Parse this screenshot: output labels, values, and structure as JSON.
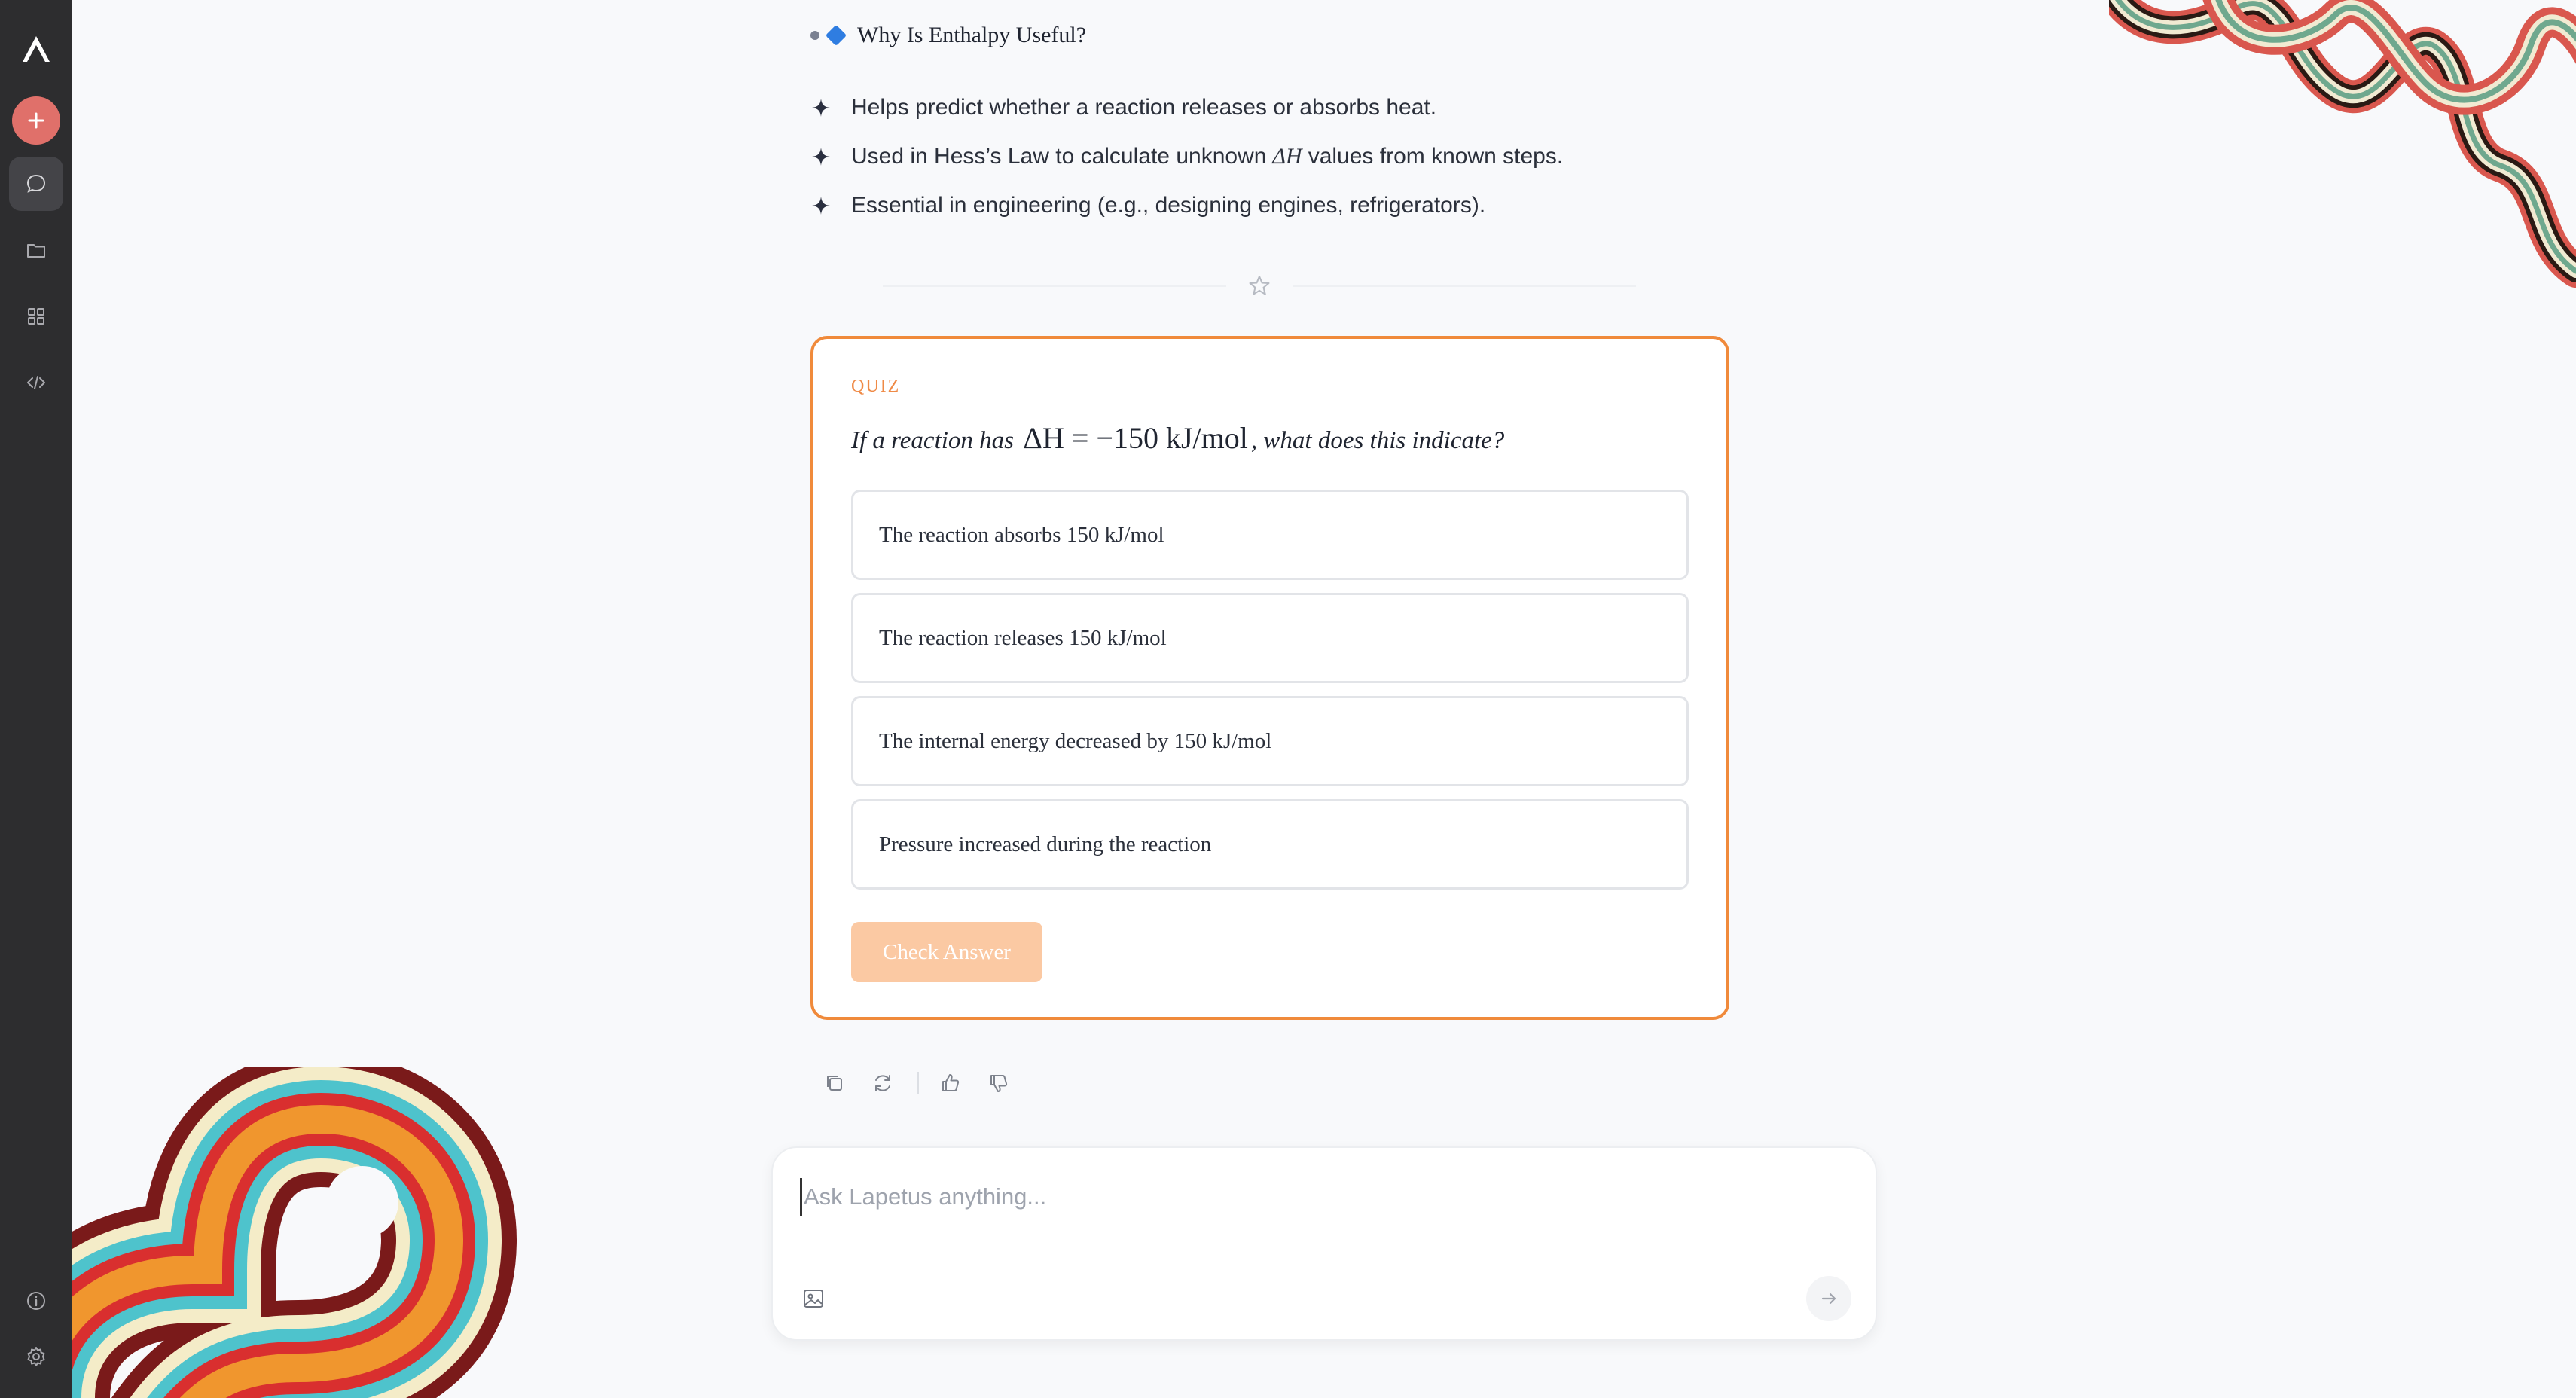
{
  "sidebar": {
    "logo": "lapetus-logo",
    "new_chat_icon": "plus-icon",
    "items": [
      {
        "name": "chat",
        "icon": "chat-bubble-icon",
        "active": true
      },
      {
        "name": "files",
        "icon": "folder-icon",
        "active": false
      },
      {
        "name": "apps",
        "icon": "grid-icon",
        "active": false
      },
      {
        "name": "code",
        "icon": "code-icon",
        "active": false
      }
    ],
    "bottom": [
      {
        "name": "info",
        "icon": "info-icon"
      },
      {
        "name": "settings",
        "icon": "gear-icon"
      }
    ]
  },
  "message": {
    "heading": "Why Is Enthalpy Useful?",
    "points": [
      {
        "text": "Helps predict whether a reaction releases or absorbs heat."
      },
      {
        "before": "Used in Hess’s Law to calculate unknown",
        "math": "ΔH",
        "after": "values from known steps."
      },
      {
        "text": "Essential in engineering (e.g., designing engines, refrigerators)."
      }
    ]
  },
  "quiz": {
    "label": "QUIZ",
    "question_before": "If a reaction has",
    "question_math": "ΔH = −150 kJ/mol",
    "question_after": ", what does this indicate?",
    "options": [
      "The reaction absorbs 150 kJ/mol",
      "The reaction releases 150 kJ/mol",
      "The internal energy decreased by 150 kJ/mol",
      "Pressure increased during the reaction"
    ],
    "check_label": "Check Answer"
  },
  "actions": [
    "copy-icon",
    "regenerate-icon",
    "thumbs-up-icon",
    "thumbs-down-icon"
  ],
  "composer": {
    "placeholder": "Ask Lapetus anything...",
    "value": "",
    "image_icon": "image-icon",
    "send_icon": "arrow-right-icon"
  },
  "colors": {
    "accent": "#f08a3b",
    "sidebar_bg": "#2d2d2f",
    "new_button": "#e0706a",
    "check_button_disabled": "#fbc9a3"
  }
}
